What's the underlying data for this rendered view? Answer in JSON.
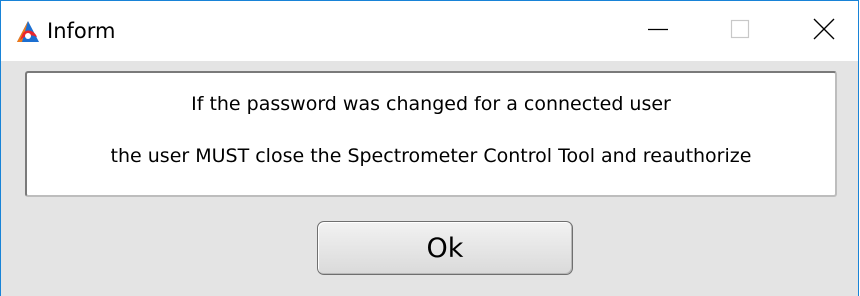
{
  "window": {
    "title": "Inform",
    "app_icon": "app-logo-icon",
    "border_color": "#1883d7"
  },
  "titlebar_controls": {
    "minimize_icon": "minimize-icon",
    "maximize_icon": "maximize-icon",
    "close_icon": "close-icon"
  },
  "message": {
    "line1": "If the password was changed for a connected user",
    "line2": "the user MUST close the Spectrometer Control Tool and reauthorize"
  },
  "buttons": {
    "ok_label": "Ok"
  }
}
